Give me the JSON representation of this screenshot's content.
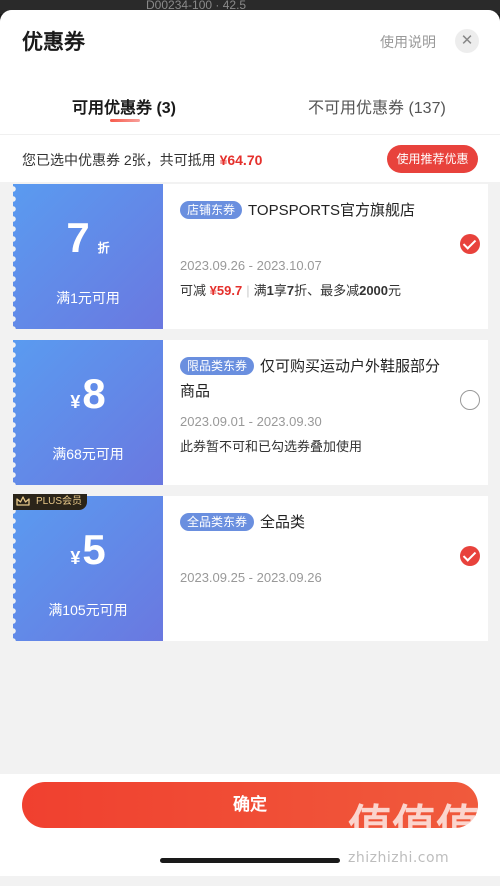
{
  "background_peek": {
    "text": "D00234-100 · 42.5"
  },
  "header": {
    "title": "优惠券",
    "help_label": "使用说明",
    "close_glyph": "✕",
    "tabs": [
      {
        "label": "可用优惠券 (3)",
        "active": true
      },
      {
        "label": "不可用优惠券 (137)",
        "active": false
      }
    ]
  },
  "selection": {
    "prefix": "您已选中优惠券 2张，共可抵用",
    "amount": "¥64.70",
    "recommend_label": "使用推荐优惠"
  },
  "coupons": [
    {
      "value": "7",
      "unit": "折",
      "symbol": "",
      "condition": "满1元可用",
      "tag": "店铺东券",
      "name": "TOPSPORTS官方旗舰店",
      "date": "2023.09.26 - 2023.10.07",
      "desc_prefix": "可减",
      "desc_amount": "¥59.7",
      "desc_rest_a": "满",
      "desc_rest_b": "1",
      "desc_rest_c": "享",
      "desc_rest_d": "7",
      "desc_rest_e": "折、最多减",
      "desc_rest_f": "2000",
      "desc_rest_g": "元",
      "selected": true,
      "plus": false
    },
    {
      "value": "8",
      "unit": "",
      "symbol": "¥",
      "condition": "满68元可用",
      "tag": "限品类东券",
      "name": "仅可购买运动户外鞋服部分商品",
      "date": "2023.09.01 - 2023.09.30",
      "desc": "此券暂不可和已勾选券叠加使用",
      "selected": false,
      "plus": false
    },
    {
      "value": "5",
      "unit": "",
      "symbol": "¥",
      "condition": "满105元可用",
      "tag": "全品类东券",
      "name": "全品类",
      "date": "2023.09.25 - 2023.09.26",
      "selected": true,
      "plus": true,
      "plus_label": "PLUS会员"
    }
  ],
  "footer": {
    "confirm_label": "确定"
  },
  "watermark": {
    "glyphs": "值值值",
    "text": "zhizhizhi.com"
  },
  "colors": {
    "accent_red": "#e8423c",
    "coupon_blue": "#5a9bf0",
    "tag_blue": "#6a8fdf"
  }
}
